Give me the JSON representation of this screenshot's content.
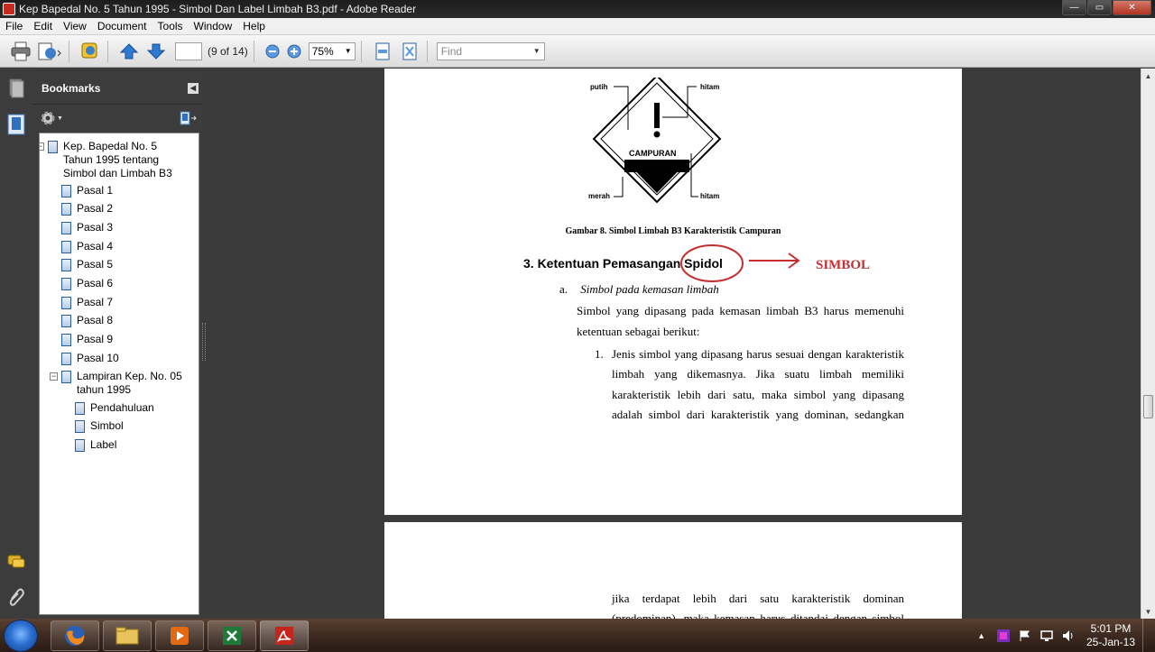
{
  "window": {
    "title": "Kep Bapedal No. 5 Tahun 1995 - Simbol Dan Label Limbah B3.pdf - Adobe Reader",
    "minimize": "—",
    "maximize": "▭",
    "close": "✕"
  },
  "menu": [
    "File",
    "Edit",
    "View",
    "Document",
    "Tools",
    "Window",
    "Help"
  ],
  "toolbar": {
    "page_value": "",
    "page_count": "(9 of 14)",
    "zoom": "75%",
    "find_placeholder": "Find"
  },
  "bookmarks": {
    "title": "Bookmarks",
    "items": [
      {
        "label": "Kep. Bapedal No. 5 Tahun 1995 tentang Simbol dan Limbah B3",
        "level": 0,
        "toggle": "−"
      },
      {
        "label": "Pasal 1",
        "level": 1
      },
      {
        "label": "Pasal 2",
        "level": 1
      },
      {
        "label": "Pasal 3",
        "level": 1
      },
      {
        "label": "Pasal 4",
        "level": 1
      },
      {
        "label": "Pasal 5",
        "level": 1
      },
      {
        "label": "Pasal 6",
        "level": 1
      },
      {
        "label": "Pasal 7",
        "level": 1
      },
      {
        "label": "Pasal 8",
        "level": 1
      },
      {
        "label": "Pasal 9",
        "level": 1
      },
      {
        "label": "Pasal 10",
        "level": 1
      },
      {
        "label": "Lampiran Kep. No. 05 tahun 1995",
        "level": 1,
        "toggle": "−"
      },
      {
        "label": "Pendahuluan",
        "level": 2
      },
      {
        "label": "Simbol",
        "level": 2
      },
      {
        "label": "Label",
        "level": 2
      }
    ]
  },
  "document": {
    "figure_labels": {
      "putih": "putih",
      "hitam_top": "hitam",
      "campuran": "CAMPURAN",
      "merah": "merah",
      "hitam_bottom": "hitam"
    },
    "caption": "Gambar 8. Simbol Limbah B3 Karakteristik Campuran",
    "heading": "3.  Ketentuan Pemasangan Spidol",
    "annotation": "SIMBOL",
    "sub_label": "a.",
    "sub_title": "Simbol pada kemasan limbah",
    "para_lines": [
      "Simbol yang dipasang pada kemasan limbah B3 harus memenuhi",
      "ketentuan sebagai berikut:"
    ],
    "list_num": "1.",
    "list_lines": [
      "Jenis simbol yang dipasang harus sesuai dengan karakteristik",
      "limbah yang dikemasnya. Jika suatu limbah memiliki",
      "karakteristik lebih dari satu, maka simbol yang dipasang",
      "adalah simbol dari karakteristik yang dominan, sedangkan"
    ],
    "page2_lines": [
      "jika terdapat lebih dari satu karakteristik dominan",
      "(predominan), maka kemasan harus ditandai dengan simbol"
    ]
  },
  "taskbar": {
    "time": "5:01 PM",
    "date": "25-Jan-13"
  },
  "colors": {
    "annotation_red": "#c62f2f",
    "panel_dark": "#3c3c3c"
  }
}
